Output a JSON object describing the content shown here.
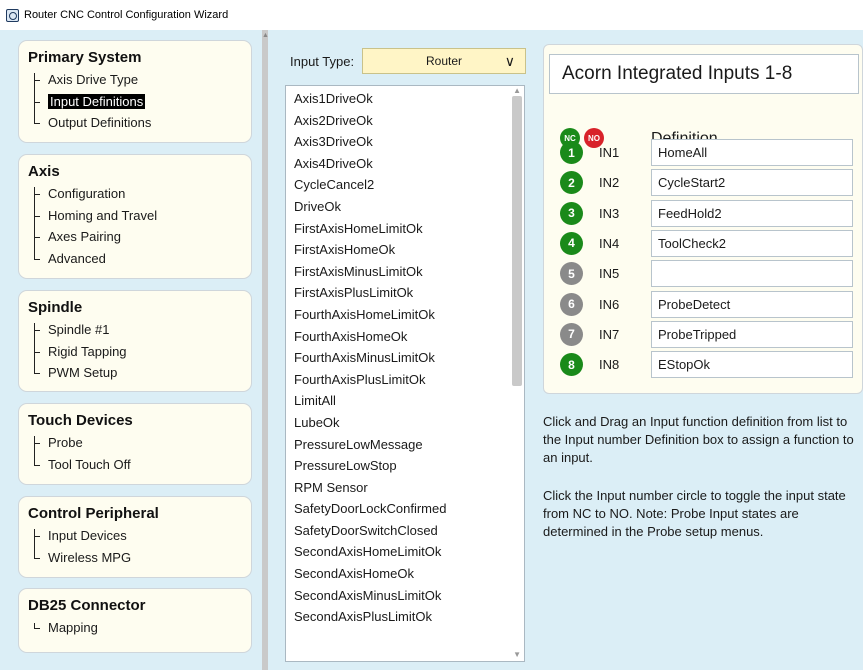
{
  "window": {
    "title": "Router CNC Control Configuration Wizard"
  },
  "colors": {
    "nc": "#1a8a1a",
    "no": "#d8222a",
    "active": "#1a8a1a",
    "inactive": "#8a8a8a",
    "panel_bg": "#dbeef6"
  },
  "nav": {
    "sections": [
      {
        "title": "Primary System",
        "items": [
          "Axis Drive Type",
          "Input Definitions",
          "Output Definitions"
        ],
        "selected": 1
      },
      {
        "title": "Axis",
        "items": [
          "Configuration",
          "Homing and Travel",
          "Axes Pairing",
          "Advanced"
        ],
        "selected": -1
      },
      {
        "title": "Spindle",
        "items": [
          "Spindle #1",
          "Rigid Tapping",
          "PWM Setup"
        ],
        "selected": -1
      },
      {
        "title": "Touch Devices",
        "items": [
          "Probe",
          "Tool Touch Off"
        ],
        "selected": -1
      },
      {
        "title": "Control Peripheral",
        "items": [
          "Input Devices",
          "Wireless MPG"
        ],
        "selected": -1
      },
      {
        "title": "DB25 Connector",
        "items": [
          "Mapping"
        ],
        "selected": -1
      }
    ]
  },
  "input_type": {
    "label": "Input Type:",
    "value": "Router"
  },
  "functions": [
    "Axis1DriveOk",
    "Axis2DriveOk",
    "Axis3DriveOk",
    "Axis4DriveOk",
    "CycleCancel2",
    "DriveOk",
    "FirstAxisHomeLimitOk",
    "FirstAxisHomeOk",
    "FirstAxisMinusLimitOk",
    "FirstAxisPlusLimitOk",
    "FourthAxisHomeLimitOk",
    "FourthAxisHomeOk",
    "FourthAxisMinusLimitOk",
    "FourthAxisPlusLimitOk",
    "LimitAll",
    "LubeOk",
    "PressureLowMessage",
    "PressureLowStop",
    "RPM Sensor",
    "SafetyDoorLockConfirmed",
    "SafetyDoorSwitchClosed",
    "SecondAxisHomeLimitOk",
    "SecondAxisHomeOk",
    "SecondAxisMinusLimitOk",
    "SecondAxisPlusLimitOk"
  ],
  "acorn": {
    "title": "Acorn Integrated Inputs 1-8",
    "nc_label": "NC",
    "no_label": "NO",
    "definition_header": "Definition",
    "inputs": [
      {
        "num": "1",
        "label": "IN1",
        "definition": "HomeAll",
        "active": true
      },
      {
        "num": "2",
        "label": "IN2",
        "definition": "CycleStart2",
        "active": true
      },
      {
        "num": "3",
        "label": "IN3",
        "definition": "FeedHold2",
        "active": true
      },
      {
        "num": "4",
        "label": "IN4",
        "definition": "ToolCheck2",
        "active": true
      },
      {
        "num": "5",
        "label": "IN5",
        "definition": "",
        "active": false
      },
      {
        "num": "6",
        "label": "IN6",
        "definition": "ProbeDetect",
        "active": false
      },
      {
        "num": "7",
        "label": "IN7",
        "definition": "ProbeTripped",
        "active": false
      },
      {
        "num": "8",
        "label": "IN8",
        "definition": "EStopOk",
        "active": true
      }
    ]
  },
  "help": {
    "drag_text": "Click and Drag an Input function definition from list to the Input number Definition box to assign a function to an input.",
    "toggle_text": "Click the Input number circle to toggle the input state from NC to NO. Note: Probe Input states are determined in the Probe setup menus."
  }
}
